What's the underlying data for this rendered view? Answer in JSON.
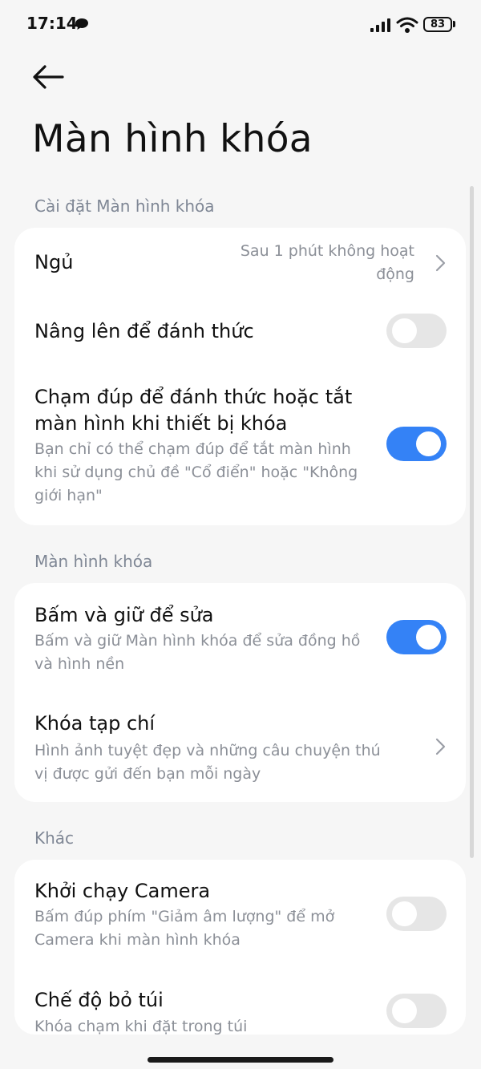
{
  "status_bar": {
    "time": "17:14",
    "battery": "83"
  },
  "header": {
    "title": "Màn hình khóa"
  },
  "sections": [
    {
      "header": "Cài đặt Màn hình khóa",
      "items": [
        {
          "title": "Ngủ",
          "value": "Sau 1 phút không hoạt động"
        },
        {
          "title": "Nâng lên để đánh thức",
          "toggle": false
        },
        {
          "title_lines": [
            "Chạm đúp để đánh thức hoặc tắt",
            "màn hình khi thiết bị khóa"
          ],
          "subtitle_lines": [
            "Bạn chỉ có thể chạm đúp để tắt màn hình",
            "khi sử dụng chủ đề \"Cổ điển\" hoặc \"Không",
            "giới hạn\""
          ],
          "toggle": true
        }
      ]
    },
    {
      "header": "Màn hình khóa",
      "items": [
        {
          "title": "Bấm và giữ để sửa",
          "subtitle_lines": [
            "Bấm và giữ Màn hình khóa để sửa đồng hồ",
            "và hình nền"
          ],
          "toggle": true
        },
        {
          "title": "Khóa tạp chí",
          "subtitle_lines": [
            "Hình ảnh tuyệt đẹp và những câu chuyện thú",
            "vị được gửi đến bạn mỗi ngày"
          ]
        }
      ]
    },
    {
      "header": "Khác",
      "items": [
        {
          "title": "Khởi chạy Camera",
          "subtitle_lines": [
            "Bấm đúp phím \"Giảm âm lượng\" để mở",
            "Camera khi màn hình khóa"
          ],
          "toggle": false
        },
        {
          "title": "Chế độ bỏ túi",
          "subtitle": "Khóa chạm khi đặt trong túi",
          "toggle": false
        }
      ]
    }
  ],
  "colors": {
    "accent": "#3482f6",
    "background": "#f6f6f6",
    "card": "#ffffff",
    "section_header": "#7f8795",
    "subtitle": "#8b8f97",
    "toggle_off": "#e6e6e6"
  },
  "icons": [
    "chat-icon",
    "signal-icon",
    "wifi-icon",
    "battery-icon",
    "back-arrow-icon",
    "chevron-right-icon"
  ]
}
